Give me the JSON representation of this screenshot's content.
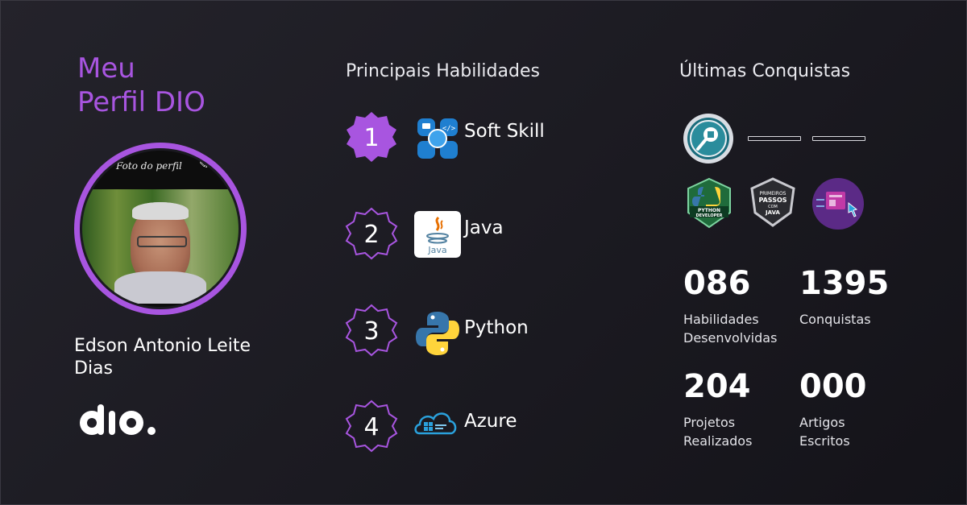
{
  "profile": {
    "title_line1": "Meu",
    "title_line2": "Perfil DIO",
    "photo_caption": "Foto do perfil",
    "name": "Edson Antonio Leite Dias"
  },
  "skills": {
    "title": "Principais Habilidades",
    "items": [
      {
        "rank": "1",
        "label": "Soft Skill",
        "icon": "soft-skill-icon"
      },
      {
        "rank": "2",
        "label": "Java",
        "icon": "java-icon"
      },
      {
        "rank": "3",
        "label": "Python",
        "icon": "python-icon"
      },
      {
        "rank": "4",
        "label": "Azure",
        "icon": "azure-icon"
      }
    ]
  },
  "achievements": {
    "title": "Últimas Conquistas",
    "badges": [
      {
        "name": "search-badge-icon",
        "text": ""
      },
      {
        "name": "python-developer-badge",
        "text": "PYTHON DEVELOPER"
      },
      {
        "name": "primeiros-passos-java-badge",
        "text": "PRIMEIROS PASSOS COM JAVA"
      },
      {
        "name": "ecommerce-badge-icon",
        "text": ""
      }
    ]
  },
  "stats": [
    {
      "value": "086",
      "label_line1": "Habilidades",
      "label_line2": "Desenvolvidas"
    },
    {
      "value": "1395",
      "label_line1": "Conquistas",
      "label_line2": ""
    },
    {
      "value": "204",
      "label_line1": "Projetos",
      "label_line2": "Realizados"
    },
    {
      "value": "000",
      "label_line1": "Artigos",
      "label_line2": "Escritos"
    }
  ],
  "colors": {
    "accent": "#a855e0",
    "background": "#1b1a21",
    "text": "#ffffff"
  }
}
